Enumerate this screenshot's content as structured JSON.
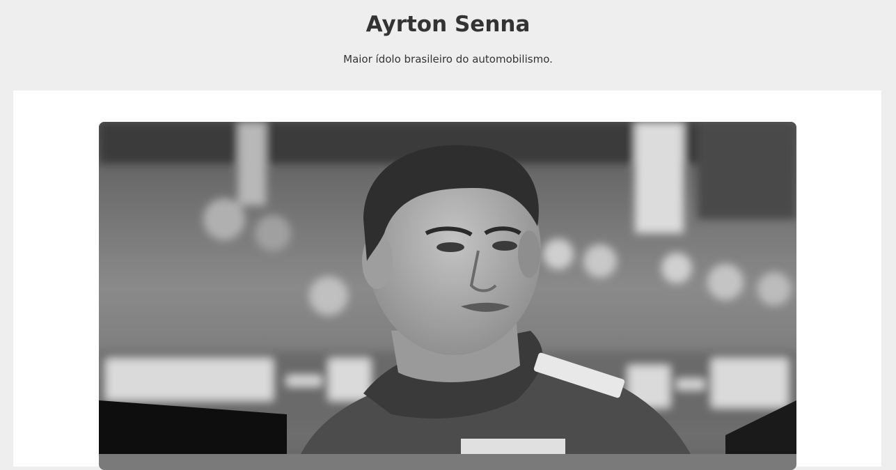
{
  "header": {
    "title": "Ayrton Senna",
    "subtitle": "Maior ídolo brasileiro do automobilismo."
  },
  "main": {
    "photo": {
      "alt": "Ayrton Senna",
      "colors": {
        "skin": "#9a9a9a",
        "hair": "#2e2e2e",
        "suit": "#4a4a4a",
        "background": "#7a7a7a"
      }
    }
  }
}
